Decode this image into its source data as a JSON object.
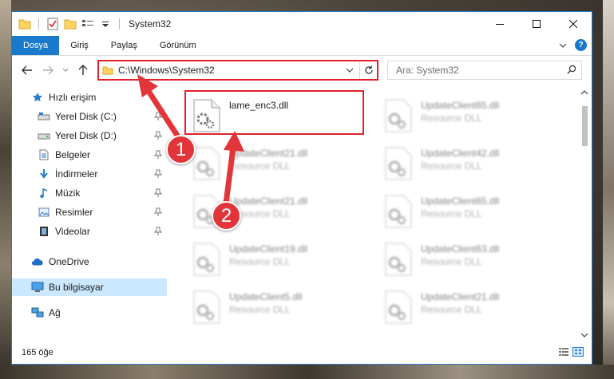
{
  "title_bar": {
    "title": "System32",
    "quick_access": [
      "folder-icon",
      "properties-check-icon",
      "new-folder-icon",
      "view-menu-icon",
      "customize-dropdown-icon"
    ],
    "controls": [
      "minimize-icon",
      "maximize-icon",
      "close-icon"
    ]
  },
  "ribbon": {
    "tabs": [
      "Dosya",
      "Giriş",
      "Paylaş",
      "Görünüm"
    ],
    "help": "?"
  },
  "address": {
    "path": "C:\\Windows\\System32",
    "search_placeholder": "Ara: System32"
  },
  "nav": {
    "quick_access": "Hızlı erişim",
    "items": [
      {
        "label": "Yerel Disk (C:)",
        "icon": "drive-c-icon",
        "pinned": true
      },
      {
        "label": "Yerel Disk (D:)",
        "icon": "drive-d-icon",
        "pinned": true
      },
      {
        "label": "Belgeler",
        "icon": "documents-icon",
        "pinned": true
      },
      {
        "label": "İndirmeler",
        "icon": "downloads-icon",
        "pinned": true
      },
      {
        "label": "Müzik",
        "icon": "music-icon",
        "pinned": true
      },
      {
        "label": "Resimler",
        "icon": "pictures-icon",
        "pinned": true
      },
      {
        "label": "Videolar",
        "icon": "videos-icon",
        "pinned": true
      }
    ],
    "onedrive": "OneDrive",
    "this_pc": "Bu bilgisayar",
    "network": "Ağ"
  },
  "files": [
    {
      "name": "lame_enc3.dll",
      "type": ""
    },
    {
      "name": "UpdateClient65.dll",
      "type": "Resource DLL"
    },
    {
      "name": "UpdateClient21.dll",
      "type": "Resource DLL"
    },
    {
      "name": "UpdateClient42.dll",
      "type": "Resource DLL"
    },
    {
      "name": "UpdateClient21.dll",
      "type": "Resource DLL"
    },
    {
      "name": "UpdateClient65.dll",
      "type": "Resource DLL"
    },
    {
      "name": "UpdateClient19.dll",
      "type": "Resource DLL"
    },
    {
      "name": "UpdateClient63.dll",
      "type": "Resource DLL"
    },
    {
      "name": "UpdateClient5.dll",
      "type": "Resource DLL"
    },
    {
      "name": "UpdateClient21.dll",
      "type": "Resource DLL"
    }
  ],
  "status": {
    "count": "165 öğe"
  },
  "callouts": [
    "1",
    "2"
  ],
  "colors": {
    "accent": "#1979ca",
    "highlight": "#e2212b",
    "callout": "#e2353a",
    "selected_nav": "#cce8ff"
  }
}
